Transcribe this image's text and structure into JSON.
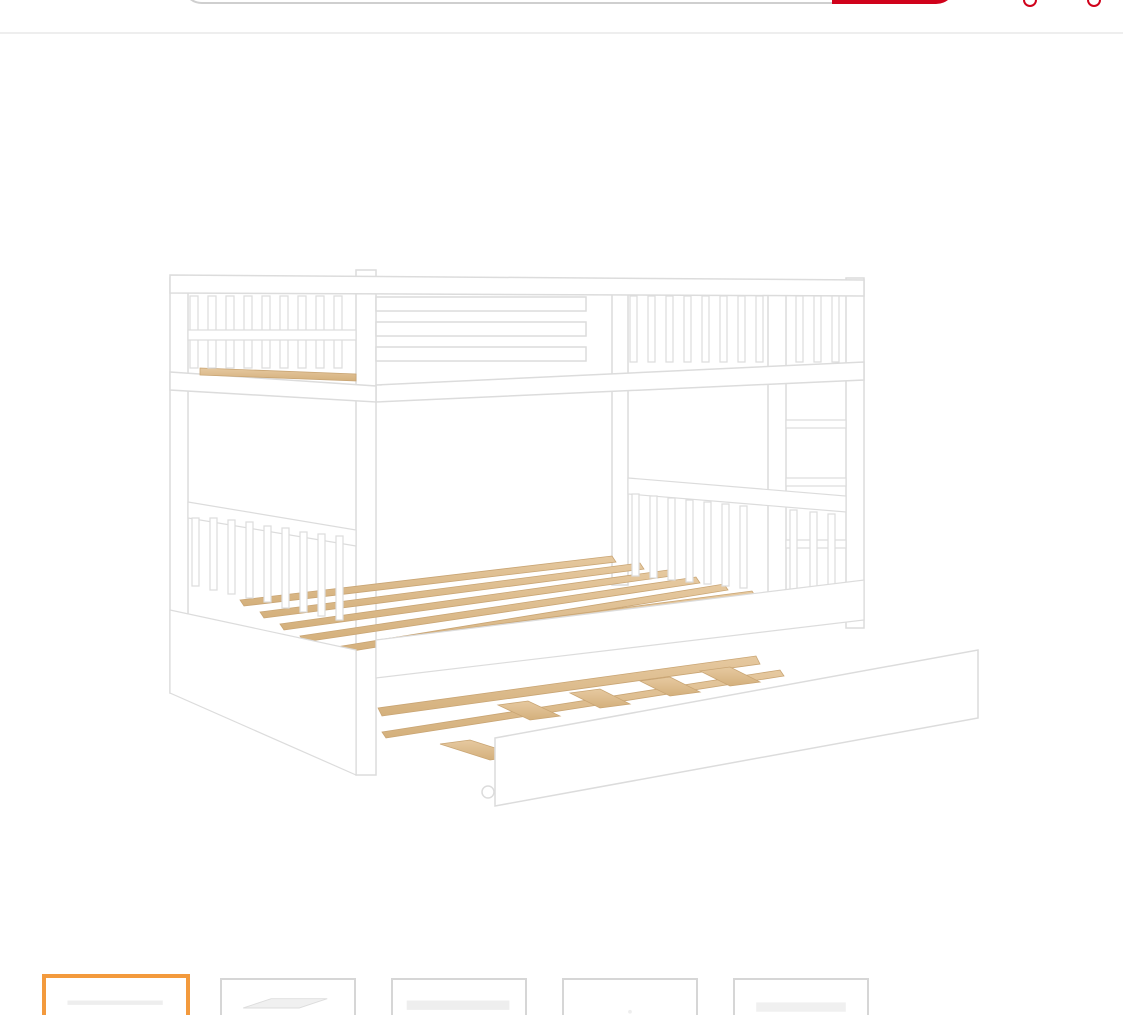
{
  "header": {
    "search": {
      "placeholder": "",
      "value": "",
      "button_color": "#d0021b"
    },
    "icons": [
      "account-icon",
      "cart-icon"
    ],
    "accent_color": "#d0021b"
  },
  "product_gallery": {
    "main_image": {
      "icon": "bunk-bed-with-trundle-image"
    },
    "thumbnails": [
      {
        "icon": "bunk-bed-front-view-thumbnail",
        "selected": true
      },
      {
        "icon": "bunk-bed-top-view-thumbnail",
        "selected": false
      },
      {
        "icon": "bunk-bed-slats-view-thumbnail",
        "selected": false
      },
      {
        "icon": "bunk-bed-detail-thumbnail",
        "selected": false
      },
      {
        "icon": "bunk-bed-side-view-thumbnail",
        "selected": false
      }
    ],
    "selected_border_color": "#f39a3d"
  }
}
